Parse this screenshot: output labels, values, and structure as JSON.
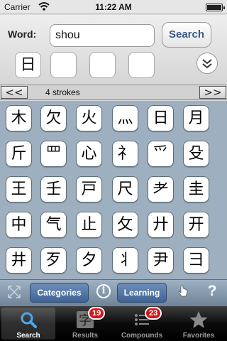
{
  "status_bar": {
    "carrier": "Carrier",
    "time": "11:22 AM",
    "battery_level": 1.0
  },
  "search": {
    "word_label": "Word:",
    "query": "shou",
    "button_label": "Search",
    "radical_slots": [
      "日",
      "",
      "",
      ""
    ]
  },
  "stroke_nav": {
    "prev_label": "<<",
    "next_label": ">>",
    "label": "4 strokes"
  },
  "kanji": [
    "木",
    "欠",
    "火",
    "灬",
    "日",
    "月",
    "斤",
    "罒",
    "心",
    "礻",
    "爫",
    "殳",
    "王",
    "壬",
    "戸",
    "尺",
    "耂",
    "圭",
    "中",
    "气",
    "止",
    "攵",
    "廾",
    "开",
    "井",
    "歹",
    "夕",
    "⺦",
    "尹",
    "彐"
  ],
  "toolbar": {
    "categories_label": "Categories",
    "learning_label": "Learning",
    "help_label": "?"
  },
  "tabs": [
    {
      "label": "Search",
      "icon": "magnifier-icon",
      "badge": "",
      "active": true
    },
    {
      "label": "Results",
      "icon": "kanji-results-icon",
      "badge": "19",
      "active": false
    },
    {
      "label": "Compounds",
      "icon": "list-icon",
      "badge": "23",
      "active": false
    },
    {
      "label": "Favorites",
      "icon": "star-icon",
      "badge": "",
      "active": false
    }
  ],
  "colors": {
    "accent_button": "#3e6396",
    "grid_background": "#9eb0bf",
    "badge": "#d5151b"
  }
}
